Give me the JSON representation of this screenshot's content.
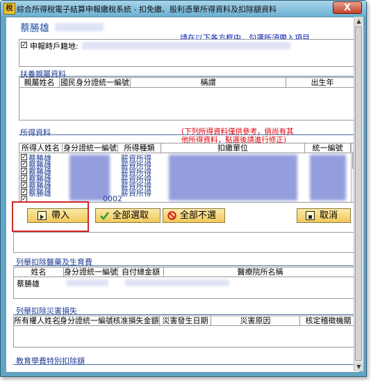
{
  "window": {
    "title": "綜合所得稅電子結算申報繳稅系統 - 扣免繳、股利憑單所得資料及扣除額資料",
    "icon_text": "稅",
    "close_label": "X"
  },
  "taxpayer": {
    "name": "蔡勝雄"
  },
  "instruction": "請在以下各方框中，勾選所須帶入項目",
  "household": {
    "label": "申報時戶籍地:"
  },
  "dependents": {
    "title": "扶養親屬資料",
    "columns": [
      "親屬姓名",
      "國民身分證統一編號",
      "稱謂",
      "出生年"
    ]
  },
  "income": {
    "title": "所得資料",
    "note_line1": "(下列所得資料僅供參考，倘尚有其",
    "note_line2": "他所得資料，點選後請進行修正)",
    "columns": [
      "所得人姓名",
      "身分證統一編號",
      "所得種類",
      "扣繳單位",
      "統一編號"
    ],
    "rows": [
      {
        "name": "蔡勝雄",
        "type": "薪資所得",
        "checked": true
      },
      {
        "name": "蔡勝雄",
        "type": "薪資所得",
        "checked": true
      },
      {
        "name": "蔡勝雄",
        "type": "薪資所得",
        "checked": true
      },
      {
        "name": "蔡勝雄",
        "type": "薪資所得",
        "checked": true
      },
      {
        "name": "蔡勝雄",
        "type": "薪資所得",
        "checked": true
      },
      {
        "name": "蔡勝雄",
        "type": "薪資所得",
        "checked": true
      }
    ],
    "partial_row_id": "0002"
  },
  "buttons": {
    "import": "帶入",
    "select_all": "全部選取",
    "deselect_all": "全部不選",
    "cancel": "取消"
  },
  "medical": {
    "title": "列舉扣除醫藥及生育費",
    "columns": [
      "姓名",
      "身分證統一編號",
      "自付總金額",
      "醫療院所名稱"
    ],
    "rows": [
      {
        "name": "蔡勝雄"
      }
    ]
  },
  "disaster": {
    "title": "列舉扣除災害損失",
    "columns": [
      "所有權人姓名",
      "身分證統一編號",
      "核准損失金額",
      "災害發生日期",
      "災害原因",
      "核定稽徵機關"
    ]
  },
  "education": {
    "title": "教育學費特別扣除額"
  },
  "colors": {
    "accent_blue": "#1f3e94",
    "note_red": "#e0000a",
    "button_gold": "#f0c95a",
    "highlight_red": "#d62424"
  }
}
